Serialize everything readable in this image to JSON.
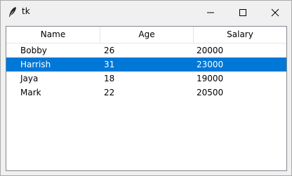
{
  "window": {
    "title": "tk",
    "icon": "feather-icon"
  },
  "controls": {
    "minimize_icon": "minimize-icon",
    "maximize_icon": "maximize-icon",
    "close_icon": "close-icon"
  },
  "table": {
    "columns": [
      "Name",
      "Age",
      "Salary"
    ],
    "rows": [
      {
        "name": "Bobby",
        "age": "26",
        "salary": "20000"
      },
      {
        "name": "Harrish",
        "age": "31",
        "salary": "23000"
      },
      {
        "name": "Jaya",
        "age": "18",
        "salary": "19000"
      },
      {
        "name": "Mark",
        "age": "22",
        "salary": "20500"
      }
    ],
    "selected_row": 1,
    "selection_color": "#0078d7"
  }
}
